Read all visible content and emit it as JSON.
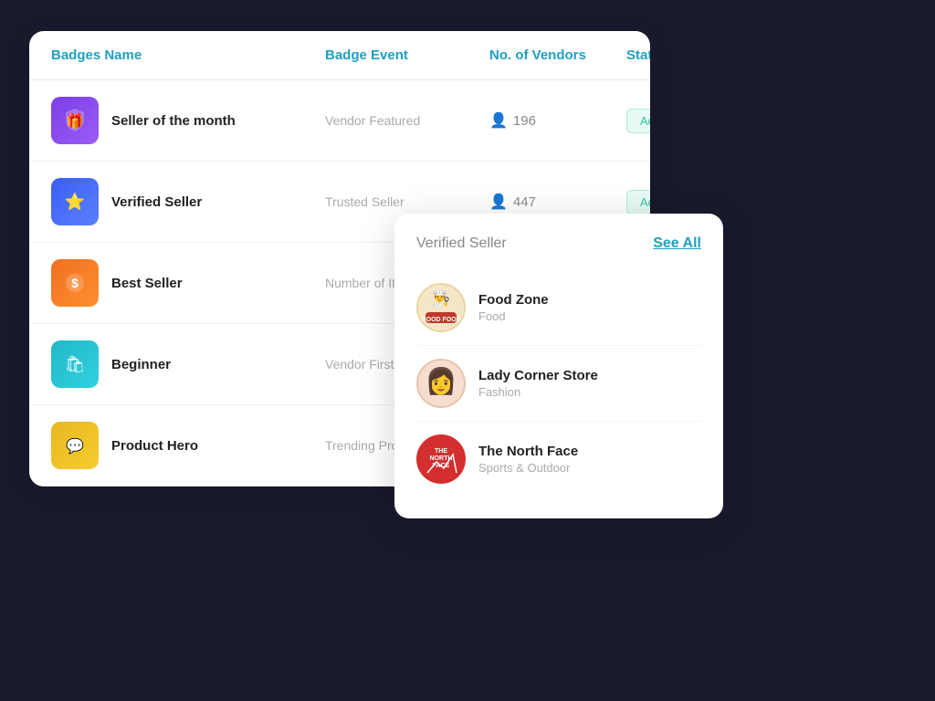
{
  "table": {
    "headers": [
      "Badges Name",
      "Badge Event",
      "No. of Vendors",
      "Status"
    ],
    "rows": [
      {
        "id": "seller-month",
        "name": "Seller of the month",
        "event": "Vendor Featured",
        "vendors": "196",
        "status": "Active",
        "icon_color": "seller-month",
        "icon_emoji": "🎁"
      },
      {
        "id": "verified-seller",
        "name": "Verified Seller",
        "event": "Trusted Seller",
        "vendors": "447",
        "status": "Active",
        "icon_color": "verified",
        "icon_emoji": "⭐"
      },
      {
        "id": "best-seller",
        "name": "Best Seller",
        "event": "Number of Item Sc...",
        "vendors": "",
        "status": "",
        "icon_color": "bestseller",
        "icon_emoji": "$"
      },
      {
        "id": "beginner",
        "name": "Beginner",
        "event": "Vendor First order...",
        "vendors": "",
        "status": "",
        "icon_color": "beginner",
        "icon_emoji": "✓"
      },
      {
        "id": "product-hero",
        "name": "Product Hero",
        "event": "Trending Product",
        "vendors": "",
        "status": "",
        "icon_color": "product-hero",
        "icon_emoji": "★"
      }
    ]
  },
  "popup": {
    "title": "Verified Seller",
    "see_all_label": "See All",
    "vendors": [
      {
        "id": "food-zone",
        "name": "Food Zone",
        "category": "Food",
        "avatar_type": "food-zone",
        "avatar_text": "GOOD\nFOOD"
      },
      {
        "id": "lady-corner",
        "name": "Lady Corner Store",
        "category": "Fashion",
        "avatar_type": "lady-corner",
        "avatar_text": "👩"
      },
      {
        "id": "north-face",
        "name": "The North Face",
        "category": "Sports & Outdoor",
        "avatar_type": "north-face",
        "avatar_text": "THE\nNORTH\nFACE"
      }
    ]
  },
  "colors": {
    "header_text": "#1e9fc4",
    "active_bg": "#e6f9f5",
    "active_text": "#2ec4a0"
  }
}
